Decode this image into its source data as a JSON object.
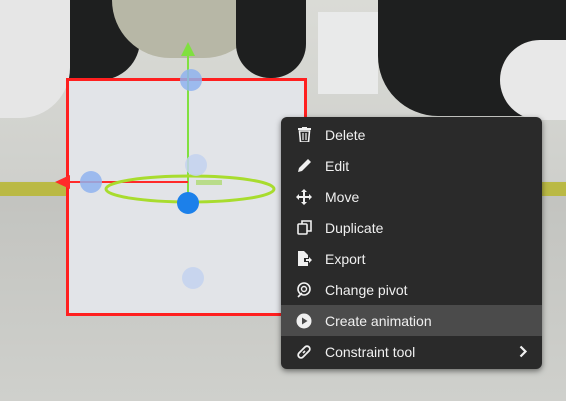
{
  "context_menu": {
    "items": [
      {
        "label": "Delete",
        "icon": "trash-icon"
      },
      {
        "label": "Edit",
        "icon": "pencil-icon"
      },
      {
        "label": "Move",
        "icon": "move-arrows-icon"
      },
      {
        "label": "Duplicate",
        "icon": "duplicate-icon"
      },
      {
        "label": "Export",
        "icon": "export-icon"
      },
      {
        "label": "Change pivot",
        "icon": "pivot-icon"
      },
      {
        "label": "Create animation",
        "icon": "play-circle-icon",
        "highlighted": true
      },
      {
        "label": "Constraint tool",
        "icon": "link-icon",
        "has_submenu": true
      }
    ]
  },
  "viewport": {
    "selection_color": "#ff1f1f",
    "gizmo_colors": {
      "x_axis": "#ff2a2a",
      "y_axis": "#80e040",
      "rotation_ring": "#a8dc2e",
      "handle": "#1c80ea"
    }
  }
}
